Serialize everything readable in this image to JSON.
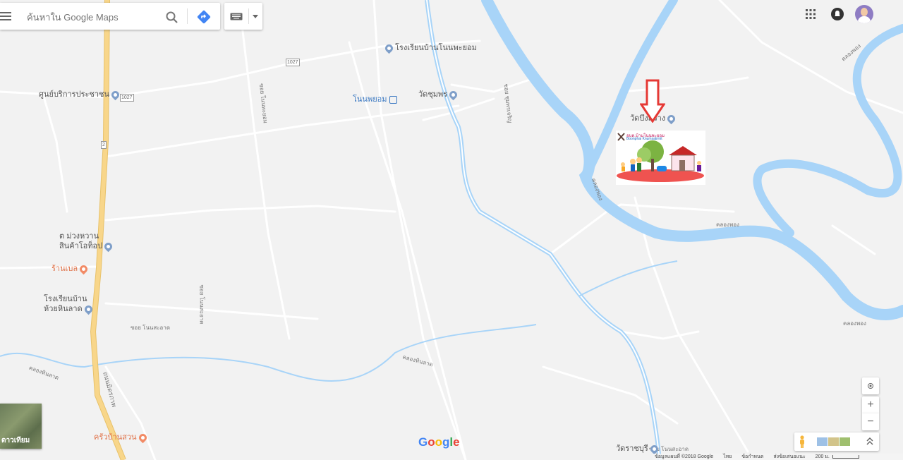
{
  "search": {
    "placeholder": "ค้นหาใน Google Maps"
  },
  "header": {
    "menu_icon": "hamburger-icon",
    "search_icon": "search-icon",
    "directions_icon": "directions-icon",
    "keyboard_icon": "keyboard-icon",
    "apps_icon": "apps-grid-icon",
    "notifications_icon": "bell-icon",
    "avatar_icon": "avatar"
  },
  "places": [
    {
      "label": "โรงเรียนบ้านโนนพะยอม",
      "kind": "blue"
    },
    {
      "label": "ศูนย์บริการประชาชน",
      "kind": "blue"
    },
    {
      "label": "โนนพยอม",
      "kind": "transit"
    },
    {
      "label": "วัดชุมพร",
      "kind": "blue"
    },
    {
      "label": "วัดบึงสว่าง",
      "kind": "blue"
    },
    {
      "label": "ต ม่วงหวาน",
      "kind": "blue"
    },
    {
      "label": "สินค้าโอท็อป",
      "kind": "blue"
    },
    {
      "label": "ร้านเบล",
      "kind": "orange"
    },
    {
      "label": "โรงเรียนบ้าน",
      "kind": "blue"
    },
    {
      "label": "ห้วยหินลาด",
      "kind": "blue"
    },
    {
      "label": "ครัวบ้านสวน",
      "kind": "orange"
    },
    {
      "label": "วัดราชบุรี",
      "kind": "blue"
    }
  ],
  "road_labels": [
    "ซอย โนนพะยอม",
    "ซอย ชุมพรเจริญ",
    "ซอย โนนสะอาด",
    "ซอย โนนสะอาด",
    "ซอย โนนสะอาด",
    "คลองหินลาด",
    "คลองหินลาด",
    "ถนนมิตรภาพ",
    "คลองพอง",
    "คลองพอง",
    "คลองพอง",
    "คลองพอง"
  ],
  "route_shields": [
    "1027",
    "1027",
    "2"
  ],
  "overlay": {
    "banner_title": "อบต.บ้านโนนพะยอม",
    "banner_subtitle": "Boonphai Knumsatrmit",
    "arrow_color": "#e53935"
  },
  "controls": {
    "locate_icon": "my-location-icon",
    "zoom_in": "+",
    "zoom_out": "−",
    "pegman_icon": "pegman-icon",
    "layers_icon": "layers-icon",
    "expand_icon": "chevron-up-icon",
    "satellite_label": "ดาวเทียม"
  },
  "brand": {
    "google_letters": [
      "G",
      "o",
      "o",
      "g",
      "l",
      "e"
    ],
    "google_colors": [
      "#4285f4",
      "#ea4335",
      "#fbbc05",
      "#4285f4",
      "#34a853",
      "#ea4335"
    ]
  },
  "footer": {
    "attribution": "ข้อมูลแผนที่ ©2018 Google",
    "language": "ไทย",
    "terms": "ข้อกำหนด",
    "feedback": "ส่งข้อเสนอแนะ",
    "scale": "200 ม."
  },
  "colors": {
    "water": "#a8d4f8",
    "road_major": "#f8d68a",
    "road_minor": "#ffffff",
    "background": "#f2f2f2"
  }
}
